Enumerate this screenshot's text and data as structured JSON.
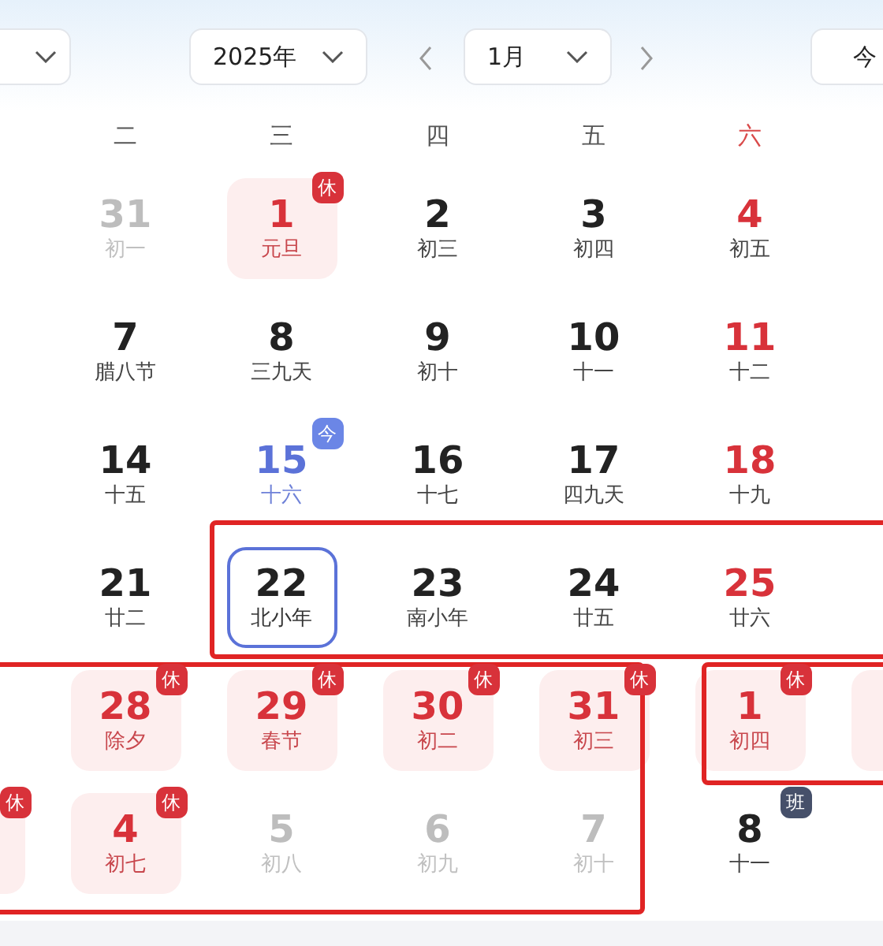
{
  "toolbar": {
    "year_picker": {
      "value": "2025年"
    },
    "month_select": {
      "value": "1月"
    },
    "today_button": {
      "label": "今"
    }
  },
  "weekdays": [
    {
      "label": "二",
      "weekend": false
    },
    {
      "label": "三",
      "weekend": false
    },
    {
      "label": "四",
      "weekend": false
    },
    {
      "label": "五",
      "weekend": false
    },
    {
      "label": "六",
      "weekend": true
    }
  ],
  "weeks": [
    {
      "days": [
        {
          "kind": "cut"
        },
        {
          "day": "31",
          "lunar": "初一",
          "kind": "other"
        },
        {
          "day": "1",
          "lunar": "元旦",
          "kind": "holiday",
          "badge": "休"
        },
        {
          "day": "2",
          "lunar": "初三",
          "kind": "normal"
        },
        {
          "day": "3",
          "lunar": "初四",
          "kind": "normal"
        },
        {
          "day": "4",
          "lunar": "初五",
          "kind": "weekend"
        },
        {
          "kind": "cut"
        }
      ]
    },
    {
      "days": [
        {
          "kind": "cut"
        },
        {
          "day": "7",
          "lunar": "腊八节",
          "kind": "normal"
        },
        {
          "day": "8",
          "lunar": "三九天",
          "kind": "normal"
        },
        {
          "day": "9",
          "lunar": "初十",
          "kind": "normal"
        },
        {
          "day": "10",
          "lunar": "十一",
          "kind": "normal"
        },
        {
          "day": "11",
          "lunar": "十二",
          "kind": "weekend"
        },
        {
          "kind": "cut"
        }
      ]
    },
    {
      "days": [
        {
          "kind": "cut"
        },
        {
          "day": "14",
          "lunar": "十五",
          "kind": "normal"
        },
        {
          "day": "15",
          "lunar": "十六",
          "kind": "today",
          "badge": "今"
        },
        {
          "day": "16",
          "lunar": "十七",
          "kind": "normal"
        },
        {
          "day": "17",
          "lunar": "四九天",
          "kind": "normal"
        },
        {
          "day": "18",
          "lunar": "十九",
          "kind": "weekend"
        },
        {
          "kind": "cut"
        }
      ]
    },
    {
      "days": [
        {
          "kind": "cut"
        },
        {
          "day": "21",
          "lunar": "廿二",
          "kind": "normal"
        },
        {
          "day": "22",
          "lunar": "北小年",
          "kind": "selected"
        },
        {
          "day": "23",
          "lunar": "南小年",
          "kind": "normal"
        },
        {
          "day": "24",
          "lunar": "廿五",
          "kind": "normal"
        },
        {
          "day": "25",
          "lunar": "廿六",
          "kind": "weekend"
        },
        {
          "kind": "cut"
        }
      ]
    },
    {
      "days": [
        {
          "kind": "cut"
        },
        {
          "day": "28",
          "lunar": "除夕",
          "kind": "holiday",
          "badge": "休"
        },
        {
          "day": "29",
          "lunar": "春节",
          "kind": "holiday",
          "badge": "休"
        },
        {
          "day": "30",
          "lunar": "初二",
          "kind": "holiday",
          "badge": "休"
        },
        {
          "day": "31",
          "lunar": "初三",
          "kind": "holiday",
          "badge": "休"
        },
        {
          "day": "1",
          "lunar": "初四",
          "kind": "holiday",
          "badge": "休"
        },
        {
          "kind": "holiday"
        }
      ]
    },
    {
      "days": [
        {
          "kind": "holiday",
          "badge": "休"
        },
        {
          "day": "4",
          "lunar": "初七",
          "kind": "holiday",
          "badge": "休"
        },
        {
          "day": "5",
          "lunar": "初八",
          "kind": "other"
        },
        {
          "day": "6",
          "lunar": "初九",
          "kind": "other"
        },
        {
          "day": "7",
          "lunar": "初十",
          "kind": "other"
        },
        {
          "day": "8",
          "lunar": "十一",
          "kind": "workday",
          "badge": "班"
        },
        {
          "kind": "cut"
        }
      ]
    }
  ]
}
